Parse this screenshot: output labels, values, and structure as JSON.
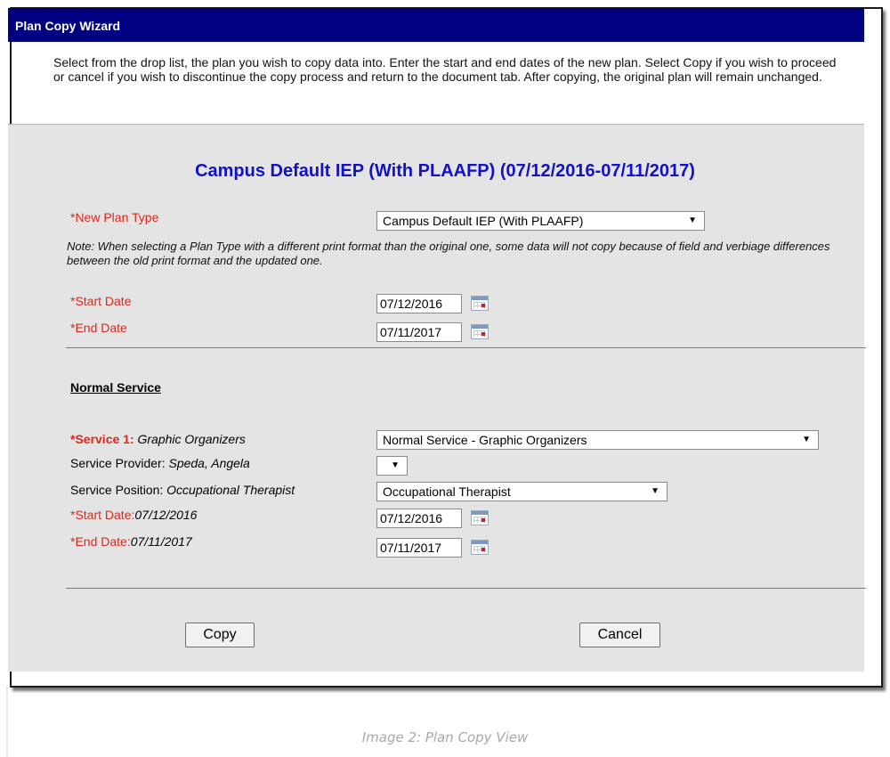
{
  "dialog": {
    "title": "Plan Copy Wizard",
    "instructions": "Select from the drop list, the plan you wish to copy data into. Enter the start and end dates of the new plan. Select Copy if you wish to proceed or cancel if you wish to discontinue the copy process and return to the document tab. After copying, the original plan will remain unchanged."
  },
  "plan": {
    "heading": "Campus Default IEP (With PLAAFP) (07/12/2016-07/11/2017)",
    "new_plan_type_label": "*New Plan Type",
    "new_plan_type_value": "Campus Default IEP (With PLAAFP)",
    "note": "Note: When selecting a Plan Type with a different print format than the original one, some data will not copy because of field and verbiage differences between the old print format and the updated one.",
    "start_date_label": "*Start Date",
    "start_date_value": "07/12/2016",
    "end_date_label": "*End Date",
    "end_date_value": "07/11/2017"
  },
  "service": {
    "section_title": "Normal Service",
    "service_label": "*Service 1:",
    "service_name": "Graphic Organizers",
    "service_value": "Normal Service - Graphic Organizers",
    "provider_label": "Service Provider:",
    "provider_name": "Speda, Angela",
    "provider_value": "",
    "position_label": "Service Position:",
    "position_name": "Occupational Therapist",
    "position_value": "Occupational Therapist",
    "start_label": "*Start Date:",
    "start_orig": "07/12/2016",
    "start_value": "07/12/2016",
    "end_label": "*End Date:",
    "end_orig": "07/11/2017",
    "end_value": "07/11/2017"
  },
  "buttons": {
    "copy": "Copy",
    "cancel": "Cancel"
  },
  "caption": "Image 2: Plan Copy View",
  "icons": {
    "dropdown": "chevron-down-icon",
    "calendar": "calendar-icon"
  },
  "colors": {
    "title_bar": "#000080",
    "heading": "#1111cc",
    "required_label": "#e1251b",
    "panel_bg": "#e4e4e4"
  }
}
